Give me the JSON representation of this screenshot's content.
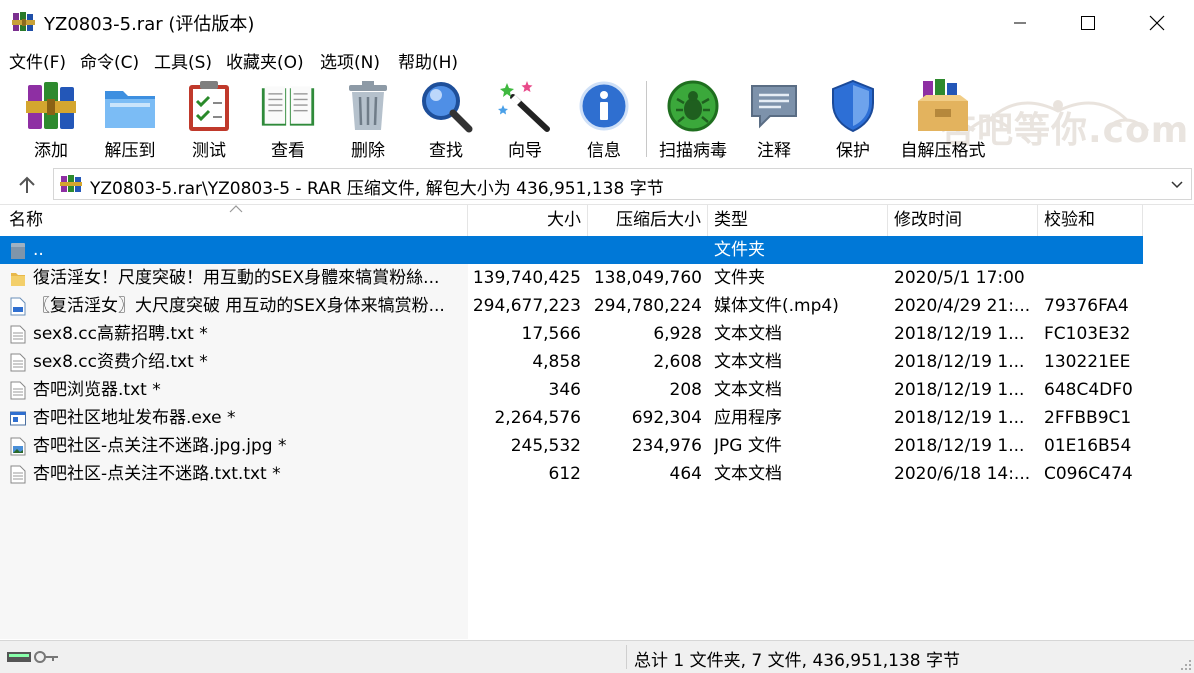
{
  "window": {
    "title": "YZ0803-5.rar (评估版本)"
  },
  "menu": [
    {
      "label": "文件(F)"
    },
    {
      "label": "命令(C)"
    },
    {
      "label": "工具(S)"
    },
    {
      "label": "收藏夹(O)"
    },
    {
      "label": "选项(N)"
    },
    {
      "label": "帮助(H)"
    }
  ],
  "toolbar": [
    {
      "label": "添加",
      "icon": "books-add-icon"
    },
    {
      "label": "解压到",
      "icon": "folder-extract-icon"
    },
    {
      "label": "测试",
      "icon": "clipboard-test-icon"
    },
    {
      "label": "查看",
      "icon": "open-book-icon"
    },
    {
      "label": "删除",
      "icon": "trash-can-icon"
    },
    {
      "label": "查找",
      "icon": "magnifier-icon"
    },
    {
      "label": "向导",
      "icon": "magic-wand-icon"
    },
    {
      "label": "信息",
      "icon": "info-icon"
    },
    {
      "label": "扫描病毒",
      "icon": "virus-scan-icon"
    },
    {
      "label": "注释",
      "icon": "comment-icon"
    },
    {
      "label": "保护",
      "icon": "shield-icon"
    },
    {
      "label": "自解压格式",
      "icon": "sfx-box-icon"
    }
  ],
  "watermark": {
    "text": "杏吧等你.com"
  },
  "address": {
    "path": "YZ0803-5.rar\\YZ0803-5 - RAR 压缩文件, 解包大小为 436,951,138 字节"
  },
  "columns": {
    "name": "名称",
    "size": "大小",
    "packed": "压缩后大小",
    "type": "类型",
    "modified": "修改时间",
    "crc": "校验和"
  },
  "rows": [
    {
      "name": "..",
      "size": "",
      "packed": "",
      "type": "文件夹",
      "modified": "",
      "crc": "",
      "icon": "parent-folder-icon",
      "selected": true
    },
    {
      "name": "復活淫女！尺度突破！用互動的SEX身體來犒賞粉絲...",
      "size": "139,740,425",
      "packed": "138,049,760",
      "type": "文件夹",
      "modified": "2020/5/1 17:00",
      "crc": "",
      "icon": "folder-icon",
      "selected": false
    },
    {
      "name": "〖复活淫女〗大尺度突破 用互动的SEX身体来犒赏粉...",
      "size": "294,677,223",
      "packed": "294,780,224",
      "type": "媒体文件(.mp4)",
      "modified": "2020/4/29 21:...",
      "crc": "79376FA4",
      "icon": "mp4-file-icon",
      "selected": false
    },
    {
      "name": "sex8.cc高薪招聘.txt *",
      "size": "17,566",
      "packed": "6,928",
      "type": "文本文档",
      "modified": "2018/12/19 1...",
      "crc": "FC103E32",
      "icon": "text-file-icon",
      "selected": false
    },
    {
      "name": "sex8.cc资费介绍.txt *",
      "size": "4,858",
      "packed": "2,608",
      "type": "文本文档",
      "modified": "2018/12/19 1...",
      "crc": "130221EE",
      "icon": "text-file-icon",
      "selected": false
    },
    {
      "name": "杏吧浏览器.txt *",
      "size": "346",
      "packed": "208",
      "type": "文本文档",
      "modified": "2018/12/19 1...",
      "crc": "648C4DF0",
      "icon": "text-file-icon",
      "selected": false
    },
    {
      "name": "杏吧社区地址发布器.exe *",
      "size": "2,264,576",
      "packed": "692,304",
      "type": "应用程序",
      "modified": "2018/12/19 1...",
      "crc": "2FFBB9C1",
      "icon": "exe-file-icon",
      "selected": false
    },
    {
      "name": "杏吧社区-点关注不迷路.jpg.jpg *",
      "size": "245,532",
      "packed": "234,976",
      "type": "JPG 文件",
      "modified": "2018/12/19 1...",
      "crc": "01E16B54",
      "icon": "image-file-icon",
      "selected": false
    },
    {
      "name": "杏吧社区-点关注不迷路.txt.txt *",
      "size": "612",
      "packed": "464",
      "type": "文本文档",
      "modified": "2020/6/18 14:...",
      "crc": "C096C474",
      "icon": "text-file-icon",
      "selected": false
    }
  ],
  "status": {
    "summary": "总计 1 文件夹, 7 文件, 436,951,138 字节"
  },
  "colors": {
    "selection": "#0078d7",
    "name_column_bg": "#f7f7f7",
    "status_bg": "#f0f0f0"
  }
}
